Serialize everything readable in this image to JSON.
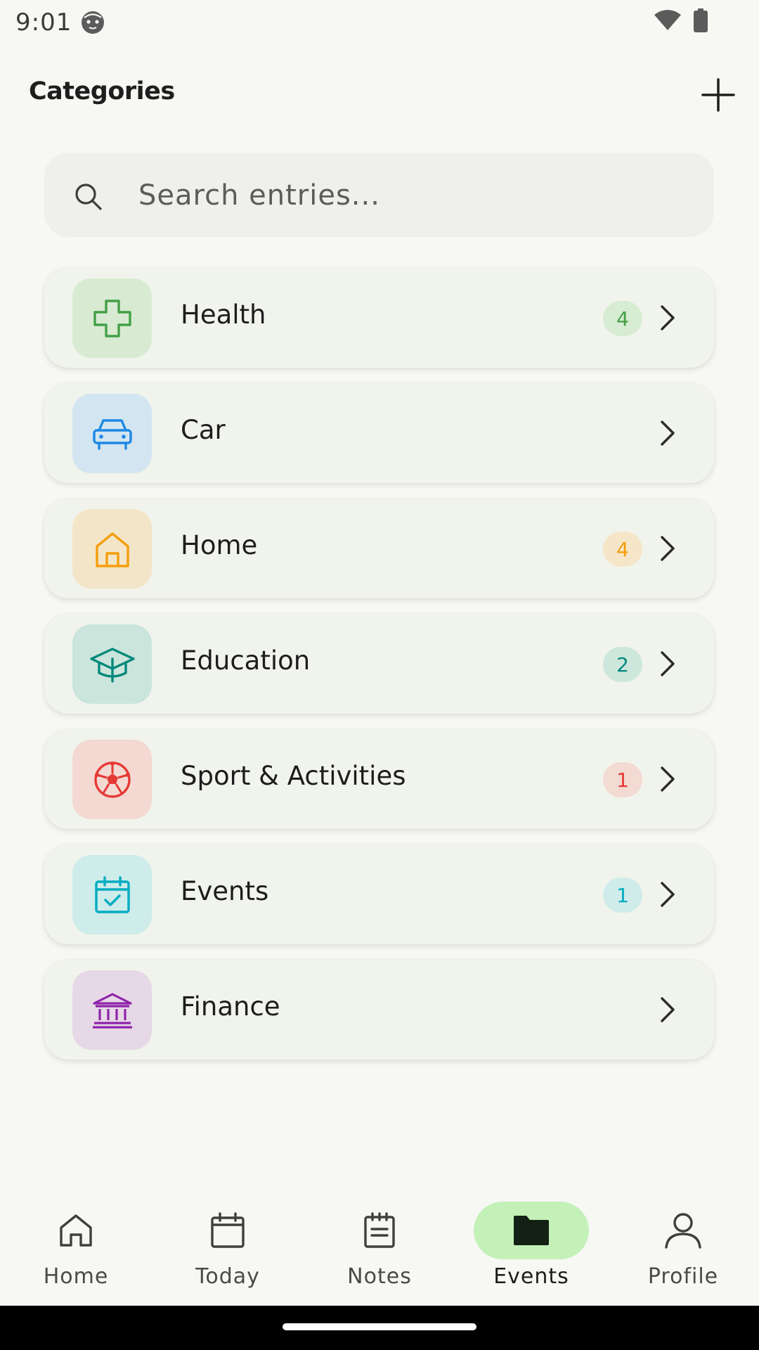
{
  "status_bar": {
    "time": "9:01"
  },
  "header": {
    "title": "Categories",
    "add_icon": "plus-icon"
  },
  "search": {
    "placeholder": "Search entries...",
    "value": "",
    "icon": "search-icon"
  },
  "categories": [
    {
      "label": "Health",
      "count": "4",
      "icon": "health-cross-icon",
      "color": "#43a047",
      "bg": "#d8ebd2",
      "badge_bg": "#d7ecd2"
    },
    {
      "label": "Car",
      "count": "",
      "icon": "car-icon",
      "color": "#1e88e5",
      "bg": "#d3e5f0",
      "badge_bg": ""
    },
    {
      "label": "Home",
      "count": "4",
      "icon": "house-icon",
      "color": "#f59e0b",
      "bg": "#f3e5c8",
      "badge_bg": "#f5e6c8"
    },
    {
      "label": "Education",
      "count": "2",
      "icon": "graduation-cap-icon",
      "color": "#00897b",
      "bg": "#cce5dc",
      "badge_bg": "#cde7dd"
    },
    {
      "label": "Sport & Activities",
      "count": "1",
      "icon": "soccer-ball-icon",
      "color": "#e53935",
      "bg": "#f3d9d2",
      "badge_bg": "#f3dad3"
    },
    {
      "label": "Events",
      "count": "1",
      "icon": "calendar-check-icon",
      "color": "#00acc1",
      "bg": "#cdecea",
      "badge_bg": "#cfecea"
    },
    {
      "label": "Finance",
      "count": "",
      "icon": "bank-icon",
      "color": "#8e24aa",
      "bg": "#e6d8e6",
      "badge_bg": ""
    }
  ],
  "bottom_nav": {
    "items": [
      {
        "label": "Home",
        "icon": "home-icon",
        "active": false
      },
      {
        "label": "Today",
        "icon": "calendar-icon",
        "active": false
      },
      {
        "label": "Notes",
        "icon": "notes-icon",
        "active": false
      },
      {
        "label": "Events",
        "icon": "folder-icon",
        "active": true
      },
      {
        "label": "Profile",
        "icon": "person-icon",
        "active": false
      }
    ],
    "active_color": "#c3f1b8"
  }
}
